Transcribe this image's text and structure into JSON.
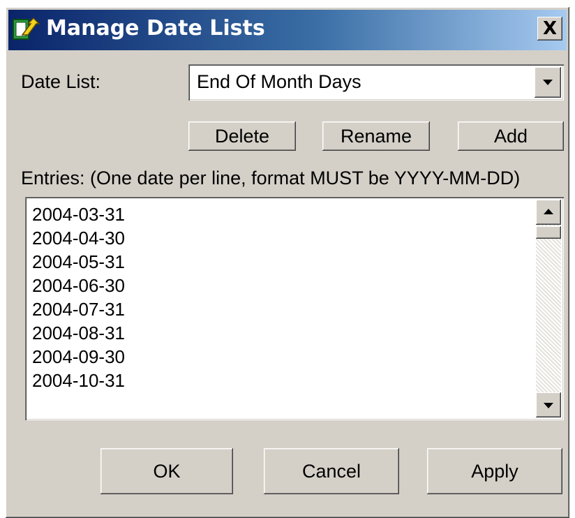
{
  "window": {
    "title": "Manage Date Lists",
    "close_label": "X"
  },
  "date_list": {
    "label": "Date List:",
    "selected": "End Of Month Days"
  },
  "list_actions": {
    "delete_label": "Delete",
    "rename_label": "Rename",
    "add_label": "Add"
  },
  "entries": {
    "label": "Entries: (One date per line, format MUST be YYYY-MM-DD)",
    "items": [
      "2004-03-31",
      "2004-04-30",
      "2004-05-31",
      "2004-06-30",
      "2004-07-31",
      "2004-08-31",
      "2004-09-30",
      "2004-10-31"
    ]
  },
  "footer": {
    "ok_label": "OK",
    "cancel_label": "Cancel",
    "apply_label": "Apply"
  },
  "colors": {
    "titlebar_start": "#0a246a",
    "titlebar_end": "#a6caf0",
    "dialog_face": "#d4d0c8"
  },
  "icons": {
    "app": "folder-arrow-icon",
    "close": "close-icon",
    "dropdown": "chevron-down-icon",
    "scroll_up": "scroll-up-arrow-icon",
    "scroll_down": "scroll-down-arrow-icon"
  }
}
